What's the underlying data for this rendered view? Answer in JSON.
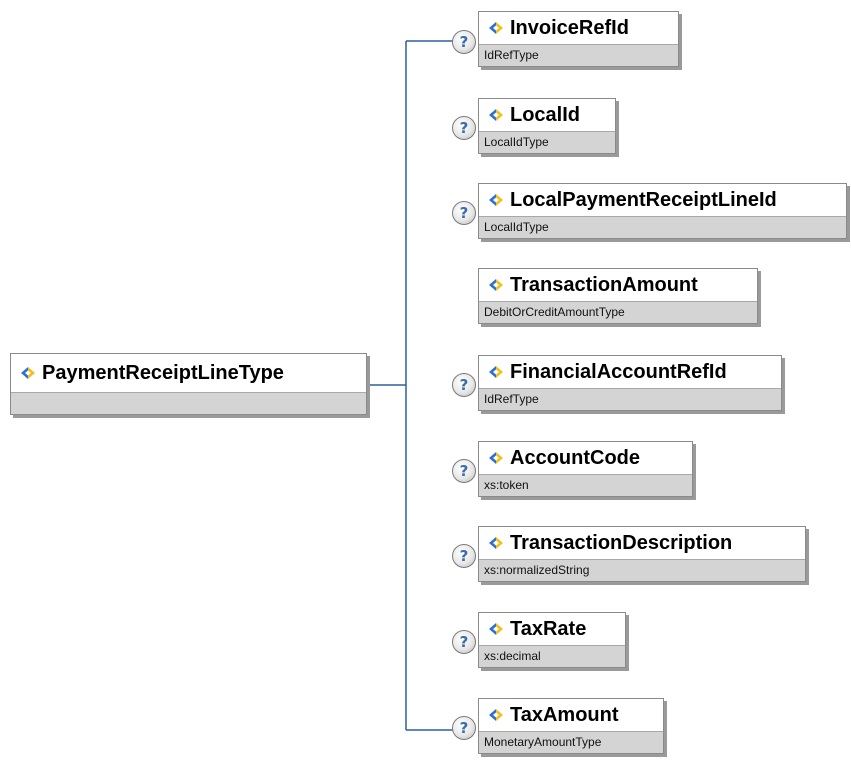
{
  "root": {
    "name": "PaymentReceiptLineType"
  },
  "elements": [
    {
      "name": "InvoiceRefId",
      "type": "IdRefType",
      "has_help": true
    },
    {
      "name": "LocalId",
      "type": "LocalIdType",
      "has_help": true
    },
    {
      "name": "LocalPaymentReceiptLineId",
      "type": "LocalIdType",
      "has_help": true
    },
    {
      "name": "TransactionAmount",
      "type": "DebitOrCreditAmountType",
      "has_help": false
    },
    {
      "name": "FinancialAccountRefId",
      "type": "IdRefType",
      "has_help": true
    },
    {
      "name": "AccountCode",
      "type": "xs:token",
      "has_help": true
    },
    {
      "name": "TransactionDescription",
      "type": "xs:normalizedString",
      "has_help": true
    },
    {
      "name": "TaxRate",
      "type": "xs:decimal",
      "has_help": true
    },
    {
      "name": "TaxAmount",
      "type": "MonetaryAmountType",
      "has_help": true
    }
  ],
  "help_symbol": "?",
  "icons": {
    "element": "element-diamond-icon",
    "help": "help-question-icon"
  },
  "colors": {
    "connector": "#2f5f9f",
    "icon_blue": "#2e6fd6",
    "icon_yellow": "#f0c020",
    "type_band": "#d4d4d4"
  }
}
